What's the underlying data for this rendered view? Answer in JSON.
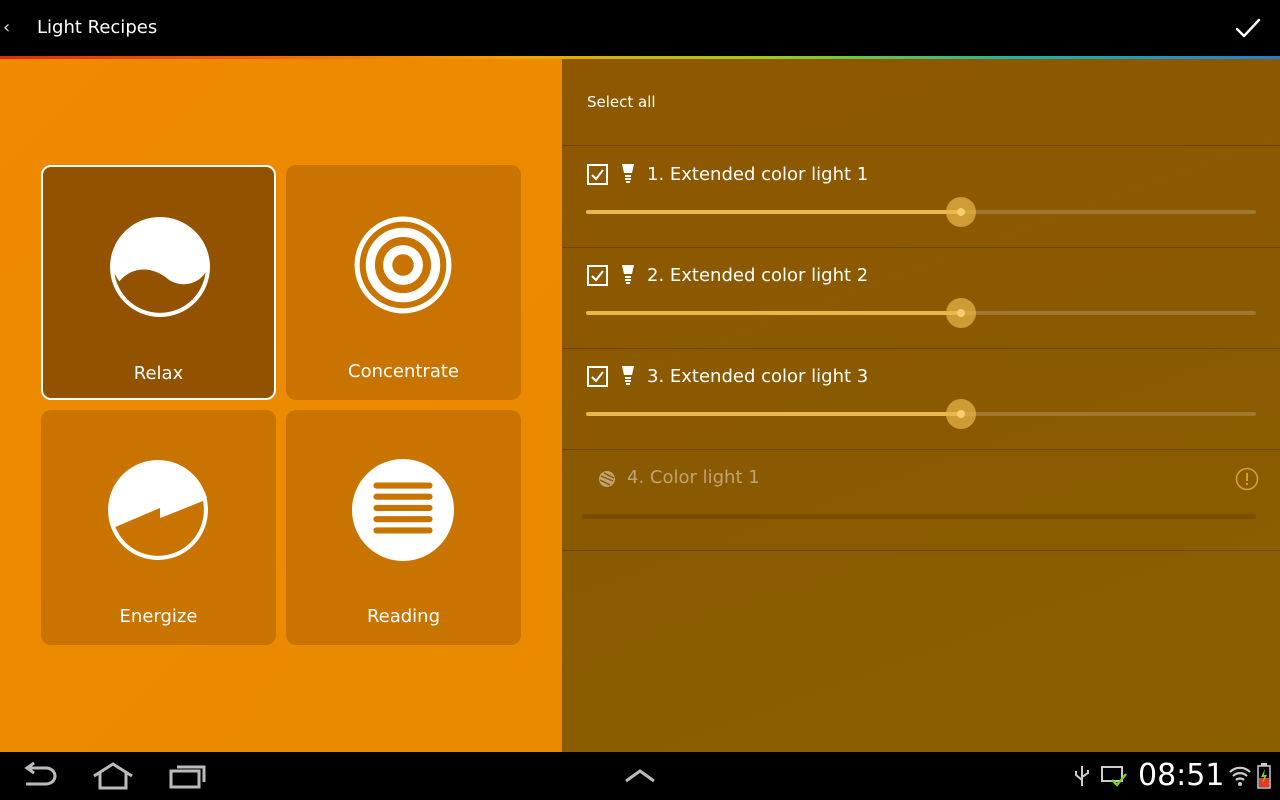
{
  "app": {
    "title": "Light Recipes"
  },
  "scenes": [
    {
      "label": "Relax",
      "icon": "relax-icon",
      "selected": true
    },
    {
      "label": "Concentrate",
      "icon": "concentrate-icon",
      "selected": false
    },
    {
      "label": "Energize",
      "icon": "energize-icon",
      "selected": false
    },
    {
      "label": "Reading",
      "icon": "reading-icon",
      "selected": false
    }
  ],
  "lights_panel": {
    "select_all_label": "Select all",
    "lights": [
      {
        "name": "1. Extended color light 1",
        "checked": true,
        "brightness_fraction": 0.56,
        "available": true
      },
      {
        "name": "2. Extended color light 2",
        "checked": true,
        "brightness_fraction": 0.56,
        "available": true
      },
      {
        "name": "3. Extended color light 3",
        "checked": true,
        "brightness_fraction": 0.56,
        "available": true
      },
      {
        "name": "4. Color light 1",
        "checked": false,
        "brightness_fraction": 0,
        "available": false
      }
    ]
  },
  "status_bar": {
    "time": "08:51"
  },
  "colors": {
    "scene_panel": "#ec8a00",
    "tile": "#c97400",
    "tile_selected": "#935200",
    "lights_panel": "#8a5a00",
    "slider_fill": "#e9b84a"
  }
}
